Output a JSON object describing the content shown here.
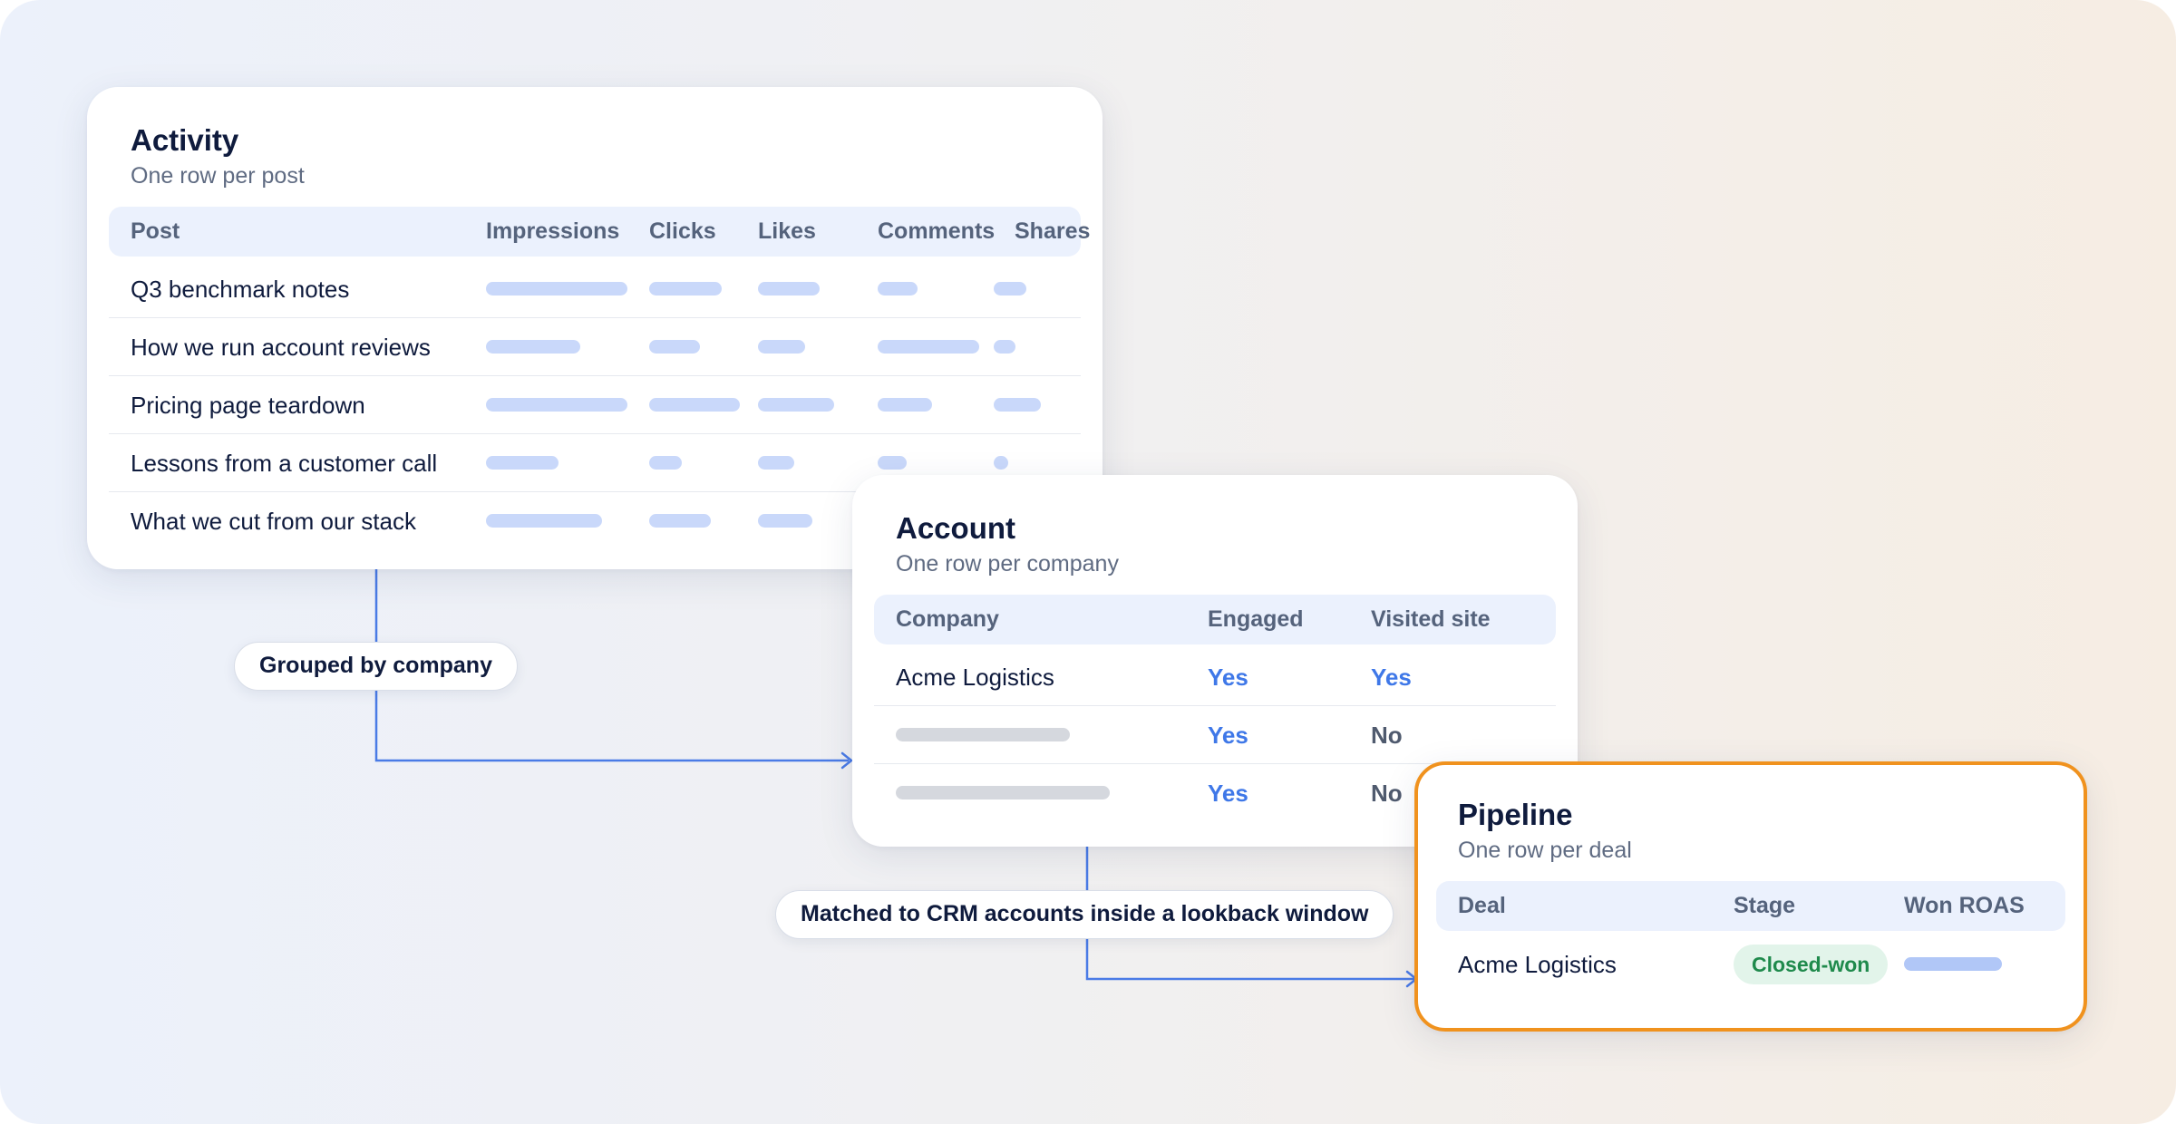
{
  "activity": {
    "title": "Activity",
    "subtitle": "One row per post",
    "columns": [
      "Post",
      "Impressions",
      "Clicks",
      "Likes",
      "Comments",
      "Shares"
    ],
    "rows": [
      "Q3 benchmark notes",
      "How we run account reviews",
      "Pricing page teardown",
      "Lessons from a customer call",
      "What we cut from our stack"
    ]
  },
  "account": {
    "title": "Account",
    "subtitle": "One row per company",
    "columns": [
      "Company",
      "Engaged",
      "Visited site"
    ],
    "rows": [
      {
        "company": "Acme Logistics",
        "engaged": "Yes",
        "visited": "Yes"
      },
      {
        "company": "",
        "engaged": "Yes",
        "visited": "No"
      },
      {
        "company": "",
        "engaged": "Yes",
        "visited": "No"
      }
    ]
  },
  "pipeline": {
    "title": "Pipeline",
    "subtitle": "One row per deal",
    "columns": [
      "Deal",
      "Stage",
      "Won ROAS"
    ],
    "rows": [
      {
        "deal": "Acme Logistics",
        "stage": "Closed-won"
      }
    ]
  },
  "connectors": {
    "grouped_label": "Grouped by company",
    "matched_label": "Matched to CRM accounts inside a lookback window"
  },
  "colors": {
    "connector": "#4a7be6",
    "accent": "#3f78e8",
    "pipeline_border": "#f0921e",
    "badge_text": "#1f8a4c"
  }
}
